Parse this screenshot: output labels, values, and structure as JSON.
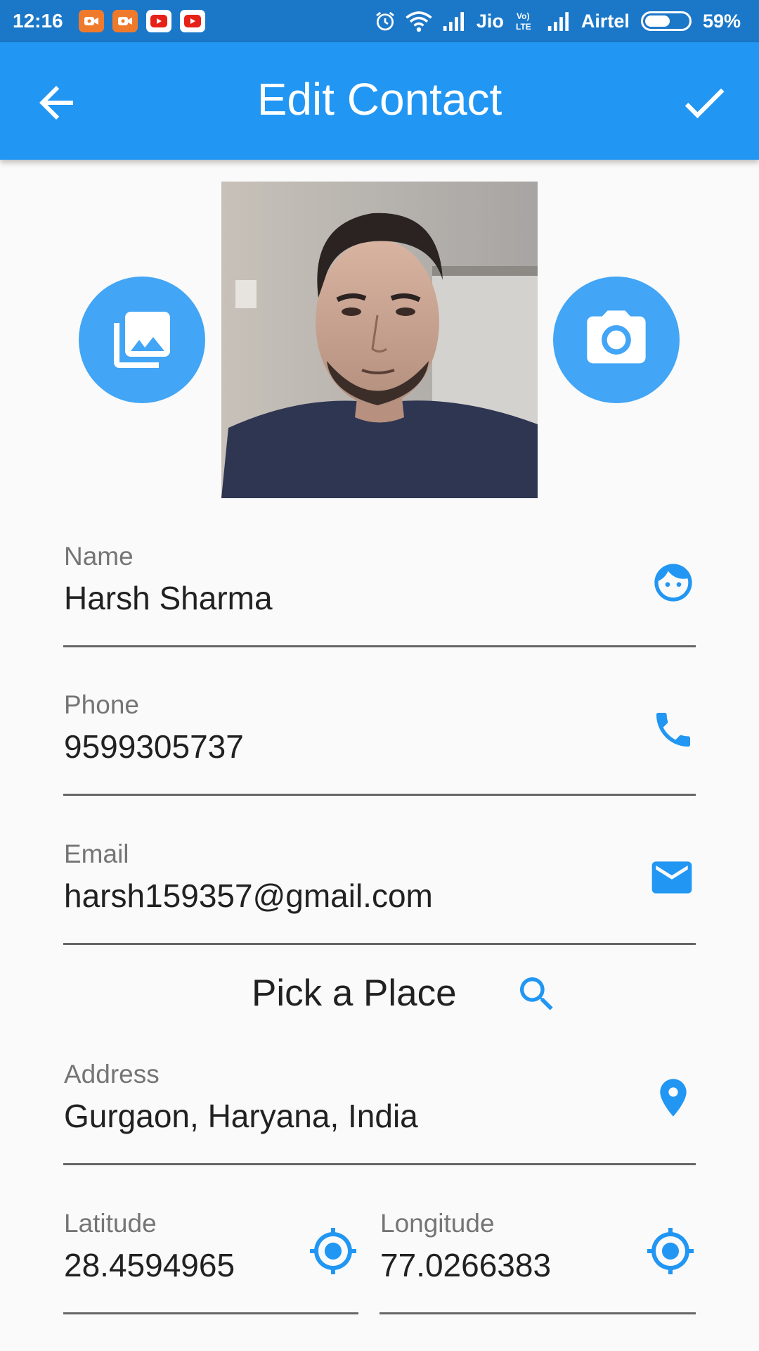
{
  "status_bar": {
    "time": "12:16",
    "carrier1": "Jio",
    "carrier2": "Airtel",
    "battery_percent": "59%",
    "battery_level": 0.59,
    "icons": [
      "screen-recorder-icon",
      "screen-recorder-icon",
      "youtube-icon",
      "youtube-icon",
      "alarm-icon",
      "wifi-icon",
      "signal-icon",
      "volte-icon",
      "signal-icon",
      "battery-icon"
    ]
  },
  "app_bar": {
    "title": "Edit Contact",
    "back_icon": "arrow-back-icon",
    "save_icon": "check-icon"
  },
  "photo": {
    "gallery_icon": "photo-library-icon",
    "camera_icon": "camera-icon"
  },
  "form": {
    "name": {
      "label": "Name",
      "value": "Harsh Sharma",
      "icon": "face-icon"
    },
    "phone": {
      "label": "Phone",
      "value": "9599305737",
      "icon": "phone-icon"
    },
    "email": {
      "label": "Email",
      "value": "harsh159357@gmail.com",
      "icon": "email-icon"
    },
    "pick_place": {
      "label": "Pick a Place",
      "icon": "search-icon"
    },
    "address": {
      "label": "Address",
      "value": "Gurgaon, Haryana, India",
      "icon": "location-pin-icon"
    },
    "latitude": {
      "label": "Latitude",
      "value": "28.4594965",
      "icon": "gps-fixed-icon"
    },
    "longitude": {
      "label": "Longitude",
      "value": "77.0266383",
      "icon": "gps-fixed-icon"
    }
  },
  "colors": {
    "status_bar": "#1b78c9",
    "app_bar": "#2196f3",
    "accent": "#42a5f5",
    "icon": "#2196f3",
    "divider": "#666666"
  }
}
